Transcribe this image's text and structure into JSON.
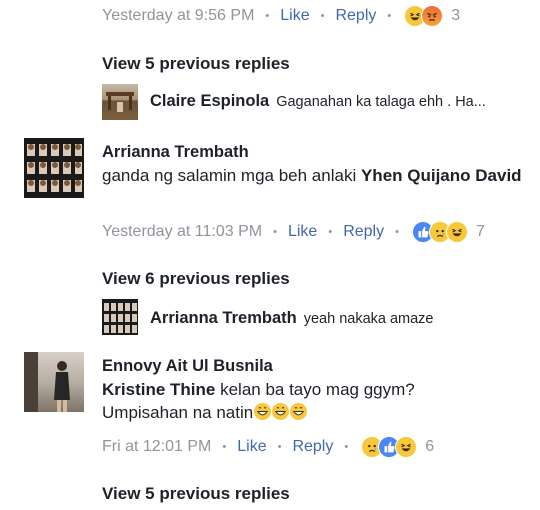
{
  "thread_top": {
    "time": "Yesterday at 9:56 PM",
    "like": "Like",
    "reply": "Reply",
    "reactions": [
      "haha-icon",
      "angry-icon"
    ],
    "count": "3"
  },
  "view1": "View 5 previous replies",
  "reply1": {
    "name": "Claire Espinola",
    "text": "Gaganahan ka talaga ehh . Ha..."
  },
  "comment2": {
    "name": "Arrianna Trembath",
    "text": "ganda ng salamin mga  beh anlaki",
    "tag": "Yhen Quijano David",
    "time": "Yesterday at 11:03 PM",
    "like": "Like",
    "reply": "Reply",
    "reactions": [
      "like-icon",
      "sad-icon",
      "haha-icon"
    ],
    "count": "7"
  },
  "view2": "View 6 previous replies",
  "reply2": {
    "name": "Arrianna Trembath",
    "text": "yeah nakaka amaze"
  },
  "comment3": {
    "name": "Ennovy Ait Ul Busnila",
    "tag": "Kristine Thine",
    "text_line1": " kelan ba tayo mag ggym?",
    "text_line2": "Umpisahan na natin",
    "time": "Fri at 12:01 PM",
    "like": "Like",
    "reply": "Reply",
    "reactions": [
      "sad-icon",
      "like-icon",
      "haha-icon"
    ],
    "count": "6"
  },
  "view3": "View 5 previous replies"
}
